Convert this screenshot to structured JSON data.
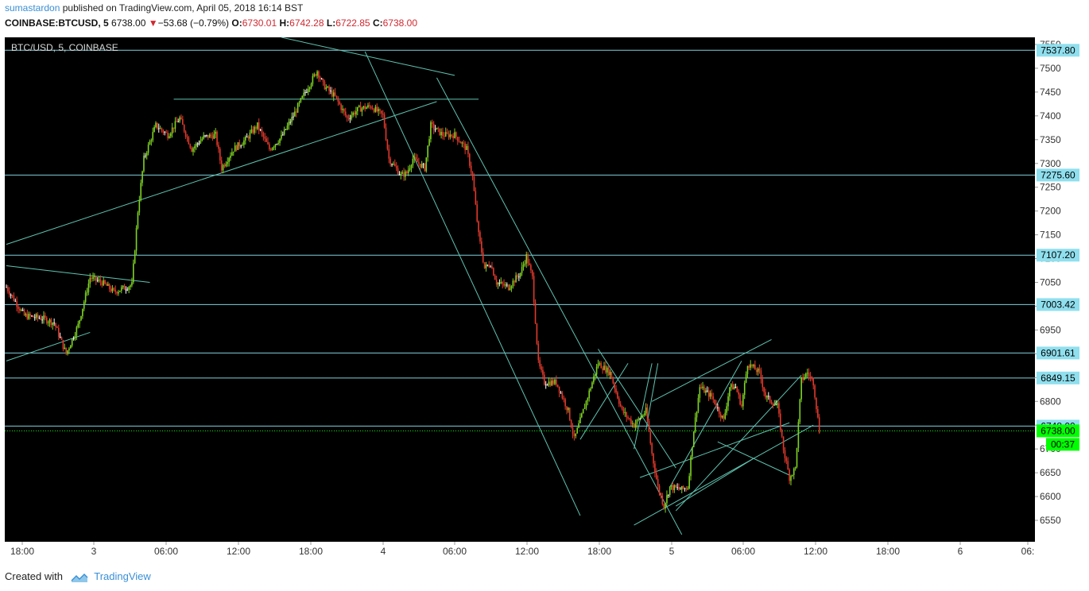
{
  "header": {
    "author": "sumastardon",
    "published_text": "published on TradingView.com, April 05, 2018 16:14 BST",
    "symbol": "COINBASE:BTCUSD, 5",
    "last": "6738.00",
    "down_arrow": "▼",
    "change": "−53.68 (−0.79%)",
    "open_label": "O:",
    "open": "6730.01",
    "high_label": "H:",
    "high": "6742.28",
    "low_label": "L:",
    "low": "6722.85",
    "close_label": "C:",
    "close": "6738.00"
  },
  "footer": {
    "created_with": "Created with",
    "brand": "TradingView"
  },
  "colors": {
    "background": "#000000",
    "level_line": "#7fcfdc",
    "trend_line": "#5fc4b0",
    "up_candle": "#7ed321",
    "down_candle": "#e0392b",
    "doji": "#ffffff",
    "price_tag": "#8fdfee",
    "current_tag": "#00ff00",
    "axis_bg": "#ffffff"
  },
  "chart_data": {
    "type": "candlestick",
    "title": "BTC/USD, 5, COINBASE",
    "ylim": [
      6505,
      7565
    ],
    "y_ticks": [
      6550,
      6600,
      6650,
      6700,
      6750,
      6800,
      6850,
      6900,
      6950,
      7000,
      7050,
      7100,
      7150,
      7200,
      7250,
      7300,
      7350,
      7400,
      7450,
      7500,
      7550
    ],
    "x_ticks": [
      "18:00",
      "3",
      "06:00",
      "12:00",
      "18:00",
      "4",
      "06:00",
      "12:00",
      "18:00",
      "5",
      "06:00",
      "12:00",
      "18:00",
      "6",
      "06:"
    ],
    "horizontal_levels": [
      {
        "price": 7537.8,
        "label": "7537.80"
      },
      {
        "price": 7275.6,
        "label": "7275.60"
      },
      {
        "price": 7107.2,
        "label": "7107.20"
      },
      {
        "price": 7003.42,
        "label": "7003.42"
      },
      {
        "price": 6901.61,
        "label": "6901.61"
      },
      {
        "price": 6849.15,
        "label": "6849.15"
      },
      {
        "price": 6748.0,
        "label": "6748.00"
      }
    ],
    "current_price": {
      "price": 6738.0,
      "label": "6738.00",
      "countdown": "00:37"
    },
    "trend_lines": [
      {
        "x1": 0.0,
        "p1": 7130,
        "x2": 72.0,
        "p2": 7430
      },
      {
        "x1": 0.0,
        "p1": 7085,
        "x2": 24.0,
        "p2": 7050
      },
      {
        "x1": 0.0,
        "p1": 6885,
        "x2": 14.0,
        "p2": 6945
      },
      {
        "x1": 28.0,
        "p1": 7435,
        "x2": 79.0,
        "p2": 7435
      },
      {
        "x1": 46.0,
        "p1": 7565,
        "x2": 75.0,
        "p2": 7485
      },
      {
        "x1": 60.0,
        "p1": 7535,
        "x2": 96.0,
        "p2": 6560
      },
      {
        "x1": 72.0,
        "p1": 7480,
        "x2": 113.0,
        "p2": 6520
      },
      {
        "x1": 96.0,
        "p1": 6720,
        "x2": 104.0,
        "p2": 6880
      },
      {
        "x1": 99.0,
        "p1": 6910,
        "x2": 112.0,
        "p2": 6660
      },
      {
        "x1": 105.0,
        "p1": 6700,
        "x2": 108.0,
        "p2": 6880
      },
      {
        "x1": 107.0,
        "p1": 6740,
        "x2": 109.0,
        "p2": 6880
      },
      {
        "x1": 108.0,
        "p1": 6800,
        "x2": 128.0,
        "p2": 6930
      },
      {
        "x1": 106.0,
        "p1": 6640,
        "x2": 131.0,
        "p2": 6755
      },
      {
        "x1": 111.0,
        "p1": 6620,
        "x2": 123.0,
        "p2": 6885
      },
      {
        "x1": 112.0,
        "p1": 6580,
        "x2": 125.0,
        "p2": 6680
      },
      {
        "x1": 119.0,
        "p1": 6715,
        "x2": 131.0,
        "p2": 6645
      },
      {
        "x1": 105.0,
        "p1": 6540,
        "x2": 135.0,
        "p2": 6750
      },
      {
        "x1": 112.0,
        "p1": 6570,
        "x2": 133.0,
        "p2": 6855
      }
    ],
    "path": [
      [
        0,
        7040
      ],
      [
        3,
        6980
      ],
      [
        6,
        6975
      ],
      [
        8,
        6965
      ],
      [
        10,
        6900
      ],
      [
        12,
        6960
      ],
      [
        14,
        7060
      ],
      [
        16,
        7050
      ],
      [
        18,
        7030
      ],
      [
        21,
        7045
      ],
      [
        22,
        7200
      ],
      [
        23,
        7310
      ],
      [
        25,
        7380
      ],
      [
        27,
        7360
      ],
      [
        29,
        7395
      ],
      [
        31,
        7330
      ],
      [
        33,
        7355
      ],
      [
        35,
        7360
      ],
      [
        36,
        7290
      ],
      [
        38,
        7330
      ],
      [
        40,
        7350
      ],
      [
        42,
        7380
      ],
      [
        44,
        7330
      ],
      [
        46,
        7355
      ],
      [
        48,
        7400
      ],
      [
        50,
        7450
      ],
      [
        52,
        7495
      ],
      [
        53,
        7465
      ],
      [
        55,
        7440
      ],
      [
        57,
        7395
      ],
      [
        59,
        7415
      ],
      [
        61,
        7420
      ],
      [
        63,
        7400
      ],
      [
        64,
        7310
      ],
      [
        66,
        7275
      ],
      [
        67,
        7280
      ],
      [
        68,
        7310
      ],
      [
        70,
        7290
      ],
      [
        71,
        7380
      ],
      [
        73,
        7360
      ],
      [
        75,
        7360
      ],
      [
        77,
        7330
      ],
      [
        78,
        7270
      ],
      [
        79,
        7150
      ],
      [
        80,
        7080
      ],
      [
        81,
        7090
      ],
      [
        82,
        7050
      ],
      [
        84,
        7040
      ],
      [
        86,
        7070
      ],
      [
        87,
        7105
      ],
      [
        88,
        7060
      ],
      [
        89,
        6880
      ],
      [
        90,
        6840
      ],
      [
        92,
        6840
      ],
      [
        94,
        6780
      ],
      [
        95,
        6720
      ],
      [
        97,
        6800
      ],
      [
        99,
        6880
      ],
      [
        101,
        6860
      ],
      [
        103,
        6780
      ],
      [
        105,
        6750
      ],
      [
        107,
        6780
      ],
      [
        108,
        6690
      ],
      [
        109,
        6620
      ],
      [
        110,
        6580
      ],
      [
        111,
        6620
      ],
      [
        113,
        6615
      ],
      [
        114,
        6620
      ],
      [
        115,
        6740
      ],
      [
        116,
        6830
      ],
      [
        118,
        6810
      ],
      [
        120,
        6760
      ],
      [
        121,
        6830
      ],
      [
        122,
        6830
      ],
      [
        123,
        6790
      ],
      [
        124,
        6880
      ],
      [
        126,
        6860
      ],
      [
        127,
        6810
      ],
      [
        129,
        6790
      ],
      [
        130,
        6700
      ],
      [
        131,
        6640
      ],
      [
        132,
        6660
      ],
      [
        133,
        6845
      ],
      [
        134,
        6860
      ],
      [
        135,
        6840
      ],
      [
        136,
        6738
      ]
    ]
  }
}
